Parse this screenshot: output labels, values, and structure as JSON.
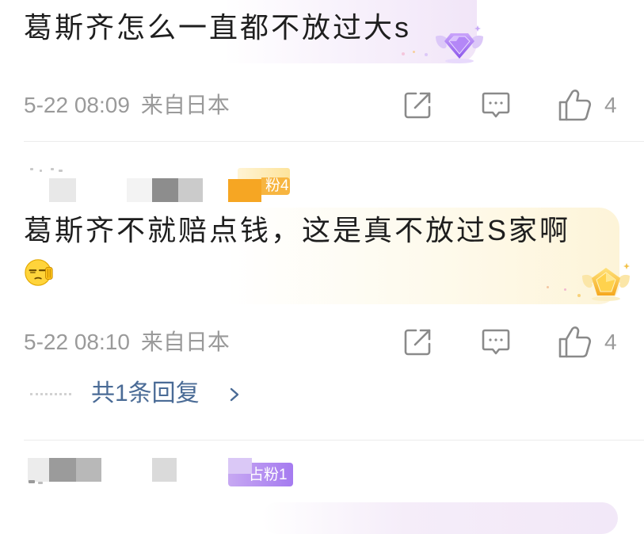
{
  "comments": [
    {
      "text": "葛斯齐怎么一直都不放过大s",
      "user_badge_icon": "purple-diamond-badge-icon",
      "time": "5-22 08:09",
      "location": "来自日本",
      "likes": "4"
    },
    {
      "fan_badge": "粉4",
      "text": "葛斯齐不就赔点钱，这是真不放过S家啊",
      "emoji_icon": "squint-face-emoji-icon",
      "user_badge_icon": "gold-pentagon-badge-icon",
      "time": "5-22 08:10",
      "location": "来自日本",
      "likes": "4",
      "replies_label": "共1条回复"
    },
    {
      "fan_badge": "占粉1"
    }
  ],
  "action_icons": [
    "share-icon",
    "comment-icon",
    "thumbs-up-icon"
  ],
  "reply_chevron_icon": "chevron-right-icon",
  "colors": {
    "comment_text": "#1e1e1e",
    "meta_text": "#9a9a9a",
    "reply_link": "#4a6b96",
    "fan_badge_orange": "#f6a623",
    "fan_badge_purple": "#a97ff0",
    "divider": "#ececec"
  }
}
